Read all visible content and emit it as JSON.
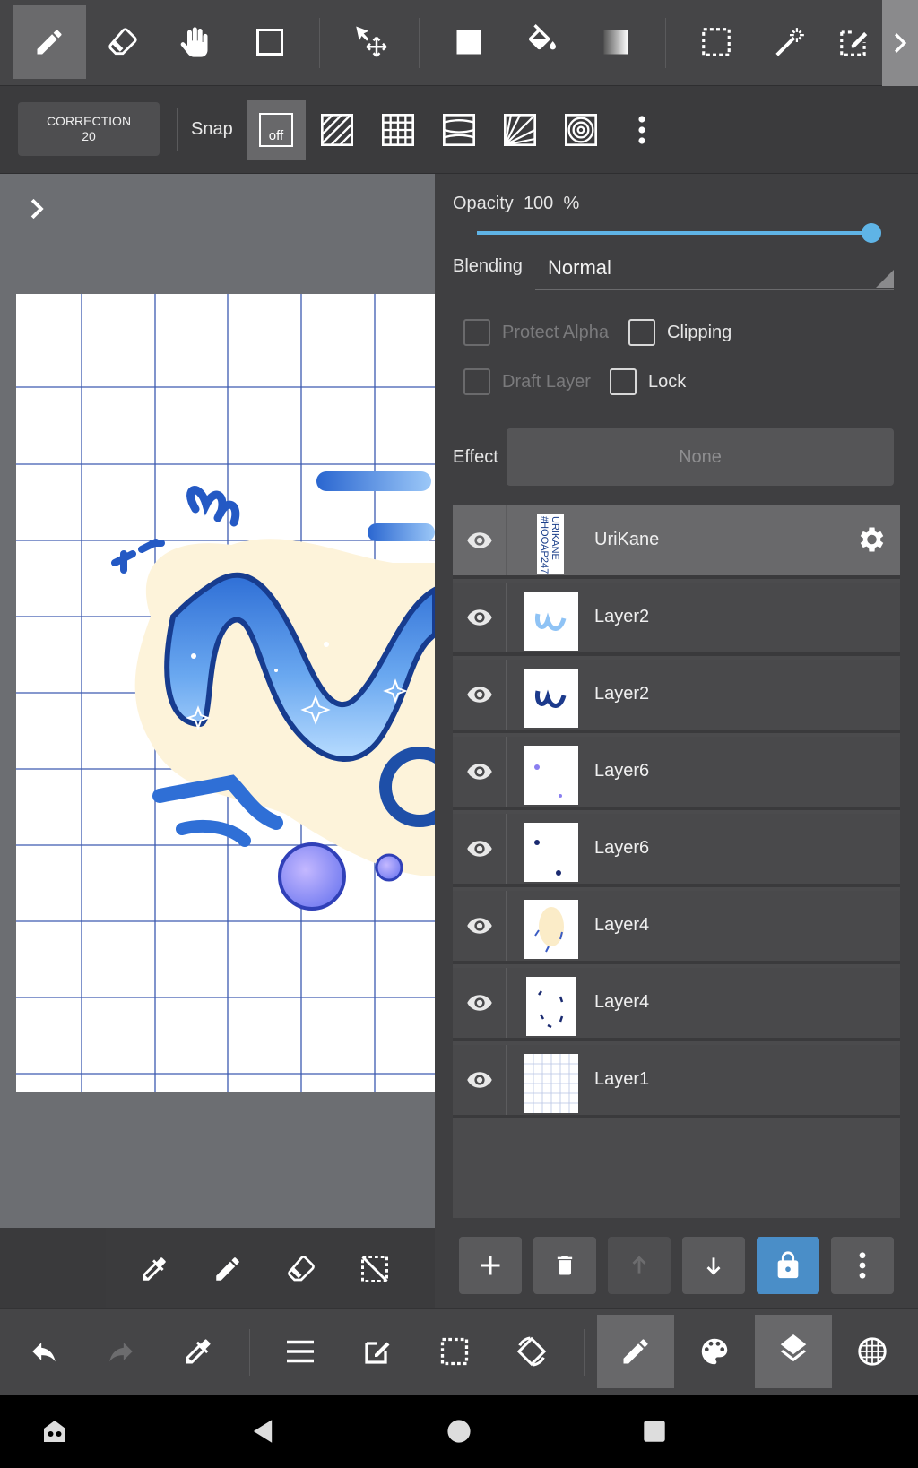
{
  "top_toolbar": {
    "tools": [
      "pencil-icon",
      "eraser-icon",
      "hand-icon",
      "shape-icon",
      "move-icon",
      "fill-rect-icon",
      "bucket-icon",
      "gradient-icon",
      "select-rect-icon",
      "magic-wand-icon",
      "select-pen-icon"
    ],
    "active_tool": "pencil-icon"
  },
  "snap_toolbar": {
    "correction_label": "CORRECTION",
    "correction_value": "20",
    "snap_label": "Snap",
    "snap_off_label": "off"
  },
  "layer_panel": {
    "opacity_label": "Opacity",
    "opacity_value": "100",
    "opacity_unit": "%",
    "opacity_fraction": 1.0,
    "blending_label": "Blending",
    "blending_value": "Normal",
    "protect_alpha_label": "Protect Alpha",
    "clipping_label": "Clipping",
    "draft_layer_label": "Draft Layer",
    "lock_label": "Lock",
    "effect_label": "Effect",
    "effect_value": "None",
    "layers": [
      {
        "name": "UriKane",
        "selected": true,
        "thumb_text": "URIKANE #HOOAP247"
      },
      {
        "name": "Layer2",
        "selected": false
      },
      {
        "name": "Layer2",
        "selected": false
      },
      {
        "name": "Layer6",
        "selected": false
      },
      {
        "name": "Layer6",
        "selected": false
      },
      {
        "name": "Layer4",
        "selected": false
      },
      {
        "name": "Layer4",
        "selected": false
      },
      {
        "name": "Layer1",
        "selected": false
      }
    ]
  },
  "colors": {
    "accent": "#4a8ec8",
    "slider": "#5fb4e6"
  }
}
